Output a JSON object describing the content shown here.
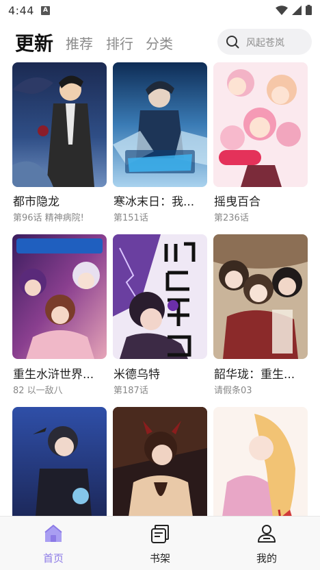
{
  "status_bar": {
    "time": "4:44",
    "notification_icon": "a-letter-icon",
    "icons": [
      "wifi-icon",
      "signal-icon",
      "battery-icon"
    ]
  },
  "header": {
    "tabs": [
      {
        "label": "更新",
        "active": true
      },
      {
        "label": "推荐",
        "active": false
      },
      {
        "label": "排行",
        "active": false
      },
      {
        "label": "分类",
        "active": false
      }
    ],
    "search": {
      "placeholder": "风起苍岚"
    }
  },
  "comics": [
    {
      "title": "都市隐龙",
      "subtitle": "第96话 精神病院!"
    },
    {
      "title": "寒冰末日：我...",
      "subtitle": "第151话"
    },
    {
      "title": "摇曳百合",
      "subtitle": "第236话"
    },
    {
      "title": "重生水浒世界...",
      "subtitle": "82 以一敌八"
    },
    {
      "title": "米德乌特",
      "subtitle": "第187话"
    },
    {
      "title": "韶华珑：重生...",
      "subtitle": "请假条03"
    },
    {
      "title": "",
      "subtitle": ""
    },
    {
      "title": "",
      "subtitle": ""
    },
    {
      "title": "",
      "subtitle": ""
    }
  ],
  "bottom_nav": {
    "items": [
      {
        "label": "首页",
        "icon": "home-icon",
        "active": true
      },
      {
        "label": "书架",
        "icon": "bookshelf-icon",
        "active": false
      },
      {
        "label": "我的",
        "icon": "profile-icon",
        "active": false
      }
    ]
  },
  "colors": {
    "accent": "#8c7ae6",
    "search_bg": "#f1f1f3",
    "nav_bg": "#f8f8f8"
  }
}
